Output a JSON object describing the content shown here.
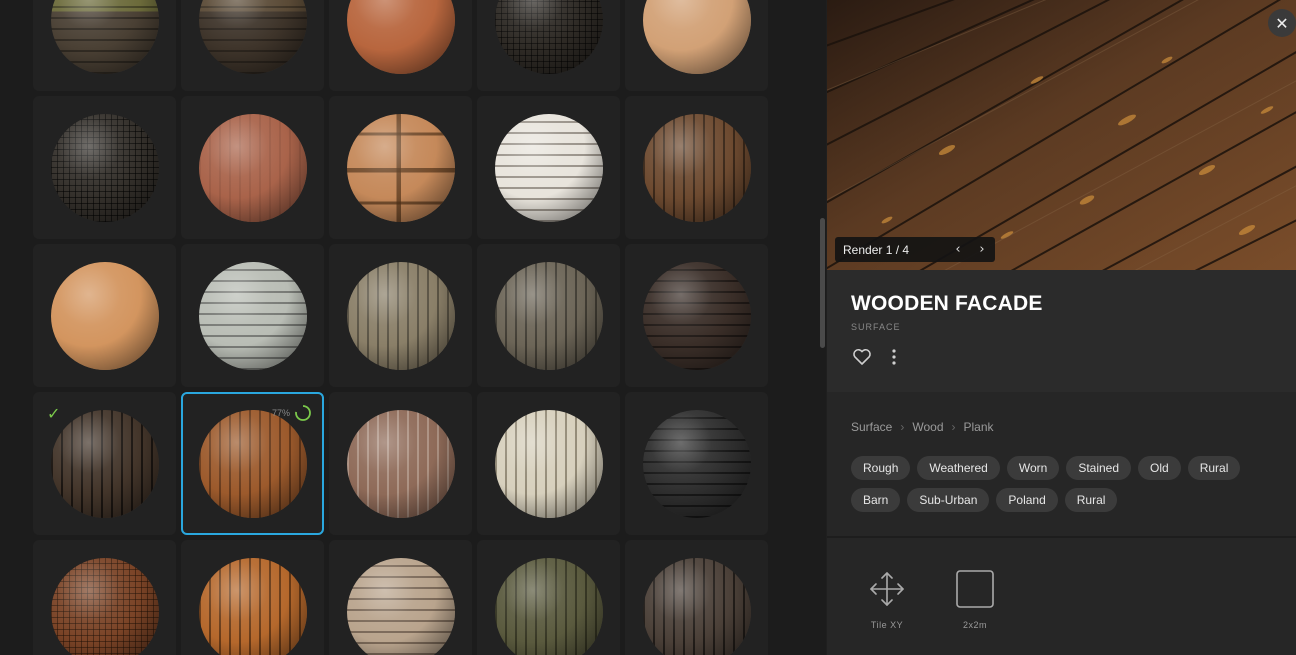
{
  "grid": {
    "progress_text": "77%",
    "rows": [
      [
        {
          "style": "sphere-1"
        },
        {
          "style": "sphere-2"
        },
        {
          "style": "sphere-3"
        },
        {
          "style": "sphere-4"
        },
        {
          "style": "sphere-5"
        }
      ],
      [
        {
          "style": "sphere-6"
        },
        {
          "style": "sphere-7"
        },
        {
          "style": "sphere-8"
        },
        {
          "style": "sphere-9"
        },
        {
          "style": "sphere-10"
        }
      ],
      [
        {
          "style": "sphere-11"
        },
        {
          "style": "sphere-12"
        },
        {
          "style": "sphere-13"
        },
        {
          "style": "sphere-14"
        },
        {
          "style": "sphere-15"
        }
      ],
      [
        {
          "style": "sphere-16",
          "downloaded": true
        },
        {
          "style": "sphere-17",
          "selected": true,
          "progress": 0.77
        },
        {
          "style": "sphere-18"
        },
        {
          "style": "sphere-19"
        },
        {
          "style": "sphere-20"
        }
      ],
      [
        {
          "style": "sphere-21"
        },
        {
          "style": "sphere-22"
        },
        {
          "style": "sphere-23"
        },
        {
          "style": "sphere-24"
        },
        {
          "style": "sphere-25"
        }
      ]
    ]
  },
  "detail": {
    "close_icon": "close-icon",
    "render_label": "Render 1 / 4",
    "title": "WOODEN FACADE",
    "type": "SURFACE",
    "breadcrumb": [
      "Surface",
      "Wood",
      "Plank"
    ],
    "tags": [
      "Rough",
      "Weathered",
      "Worn",
      "Stained",
      "Old",
      "Rural",
      "Barn",
      "Sub-Urban",
      "Poland",
      "Rural"
    ],
    "maps": [
      {
        "icon": "move-arrows-icon",
        "label": "Tile XY"
      },
      {
        "icon": "square-icon",
        "label": "2x2m"
      }
    ]
  },
  "colors": {
    "accent": "#2aa7de",
    "check": "#7bc94b",
    "tag_bg": "#3b3b3b"
  }
}
